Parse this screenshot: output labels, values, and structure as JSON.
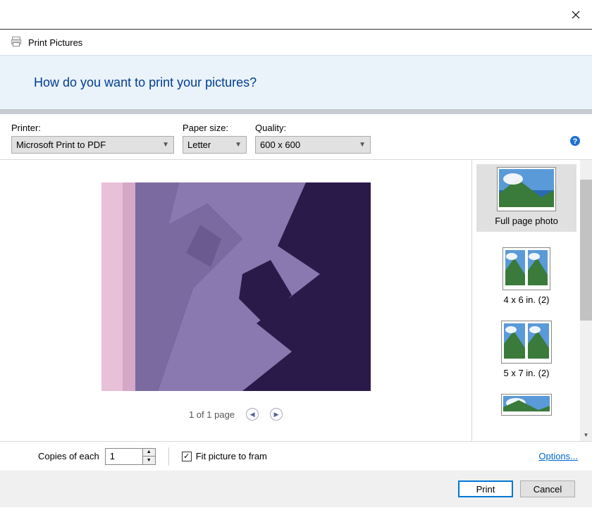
{
  "window": {
    "title": "Print Pictures"
  },
  "banner": {
    "text": "How do you want to print your pictures?"
  },
  "controls": {
    "printer_label": "Printer:",
    "printer_value": "Microsoft Print to PDF",
    "paper_label": "Paper size:",
    "paper_value": "Letter",
    "quality_label": "Quality:",
    "quality_value": "600 x 600"
  },
  "preview": {
    "page_text": "1 of 1 page"
  },
  "layouts": [
    {
      "label": "Full page photo",
      "selected": true
    },
    {
      "label": "4 x 6 in. (2)",
      "selected": false
    },
    {
      "label": "5 x 7 in. (2)",
      "selected": false
    }
  ],
  "bottom": {
    "copies_label": "Copies of each",
    "copies_value": "1",
    "fit_label": "Fit picture to fram",
    "fit_checked": true,
    "options_link": "Options..."
  },
  "buttons": {
    "print": "Print",
    "cancel": "Cancel"
  }
}
